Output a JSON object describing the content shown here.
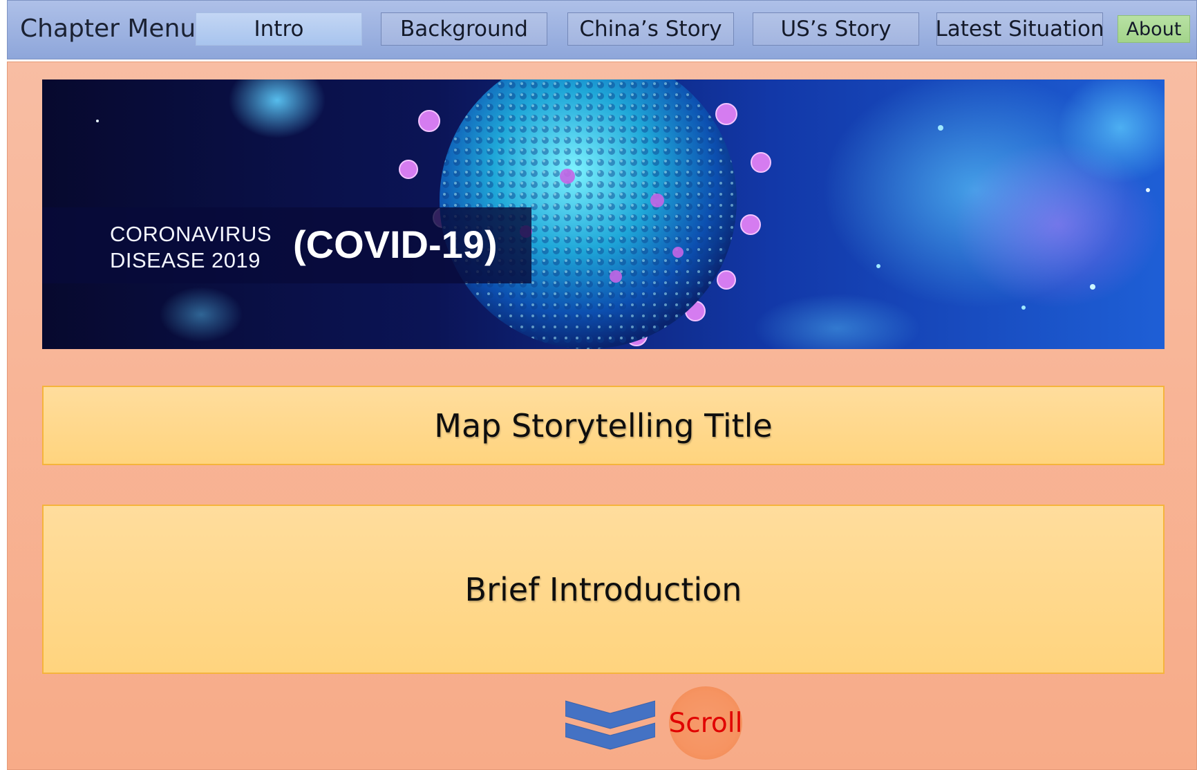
{
  "menu": {
    "title": "Chapter Menu",
    "tabs": [
      {
        "label": "Intro"
      },
      {
        "label": "Background"
      },
      {
        "label": "China’s Story"
      },
      {
        "label": "US’s Story"
      },
      {
        "label": "Latest Situation"
      },
      {
        "label": "About"
      }
    ],
    "active_tab": "Intro"
  },
  "banner": {
    "line1": "CORONAVIRUS",
    "line2": "DISEASE 2019",
    "big": "(COVID-19)"
  },
  "main": {
    "title_card": "Map Storytelling Title",
    "intro_card": "Brief Introduction"
  },
  "scroll": {
    "label": "Scroll",
    "icon": "double-chevron-down-icon"
  },
  "colors": {
    "menu_bg": "#a3b5e0",
    "panel_bg": "#f7b396",
    "card_bg": "#ffd98a",
    "about_bg": "#a8d690",
    "scroll_text": "#e00000",
    "chevron": "#4472c4"
  }
}
